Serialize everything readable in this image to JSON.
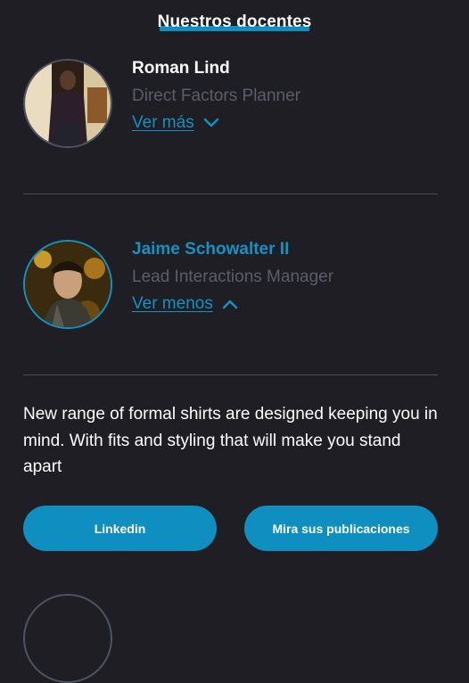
{
  "section": {
    "title": "Nuestros docentes"
  },
  "teachers": [
    {
      "name": "Roman Lind",
      "role": "Direct Factors Planner",
      "toggle_label": "Ver más",
      "expanded": false,
      "toggle_icon": "chevron-down-icon"
    },
    {
      "name": "Jaime Schowalter II",
      "role": "Lead Interactions Manager",
      "toggle_label": "Ver menos",
      "expanded": true,
      "toggle_icon": "chevron-up-icon",
      "description": "New range of formal shirts are designed keeping you in mind. With fits and styling that will make you stand apart",
      "buttons": {
        "linkedin": "Linkedin",
        "publications": "Mira sus publicaciones"
      }
    }
  ],
  "colors": {
    "background": "#1e1e24",
    "accent": "#1592c2",
    "button": "#0f8fbf",
    "muted_text": "#5a5e6a",
    "divider": "#4a4d57"
  }
}
